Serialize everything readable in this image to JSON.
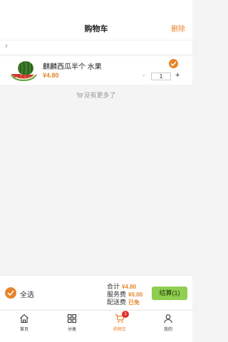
{
  "header": {
    "title": "购物车",
    "delete_label": "删除"
  },
  "cart_items": [
    {
      "name": "麒麟西瓜半个 水果",
      "price": "¥4.80",
      "quantity": "1",
      "selected": true,
      "image_icon": "watermelon-image"
    }
  ],
  "no_more_text": "没有更多了",
  "bottom_bar": {
    "select_all_label": "全选",
    "total_label": "合计",
    "total_value": "¥4.80",
    "service_fee_label": "服务费",
    "service_fee_value": "¥0.00",
    "delivery_fee_label": "配送费",
    "delivery_fee_value": "已免",
    "checkout_label": "结算(1)"
  },
  "tabbar": {
    "items": [
      {
        "label": "首页",
        "icon": "home-icon"
      },
      {
        "label": "分类",
        "icon": "grid-icon"
      },
      {
        "label": "购物车",
        "icon": "cart-icon",
        "badge": "1",
        "active": true
      },
      {
        "label": "我的",
        "icon": "person-icon"
      }
    ]
  },
  "colors": {
    "accent": "#e8842b",
    "checkout_bg": "#8fce4f",
    "badge": "#e0332b"
  }
}
